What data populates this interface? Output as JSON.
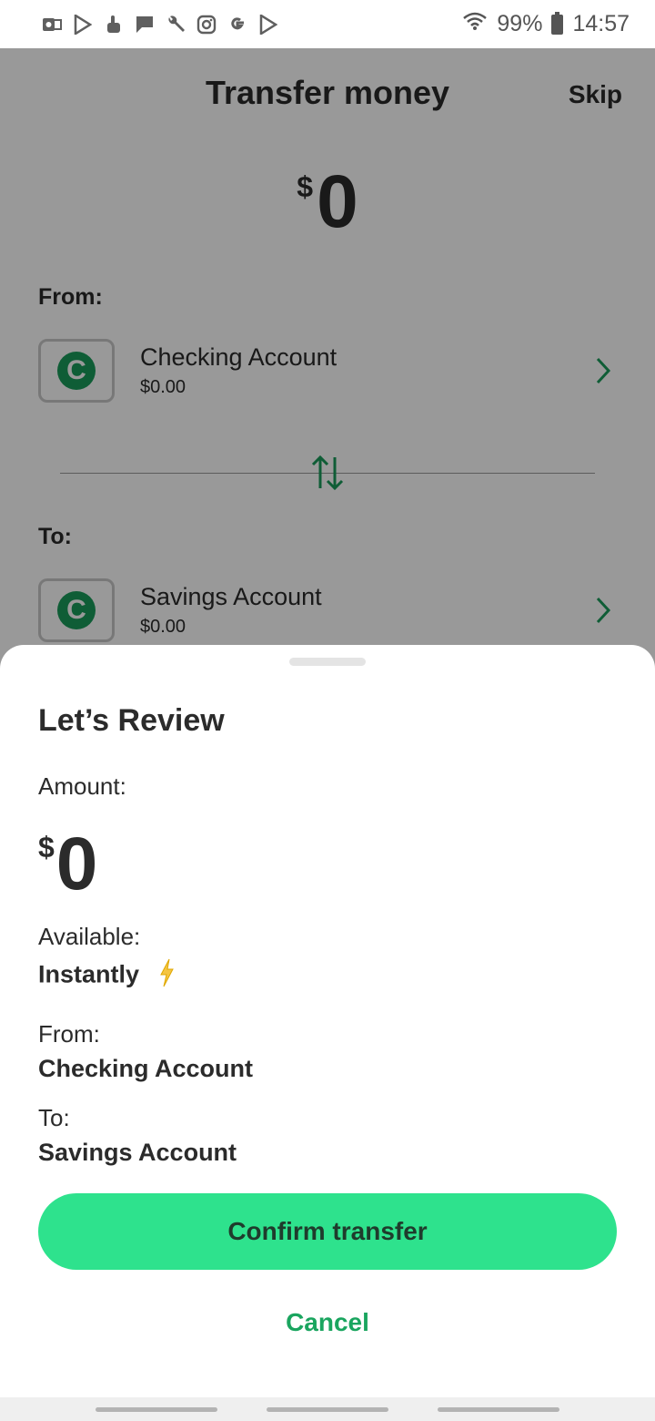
{
  "status_bar": {
    "battery": "99%",
    "time": "14:57",
    "left_icons": [
      "outlook-icon",
      "play-store-icon",
      "hand-icon",
      "flag-icon",
      "wrench-icon",
      "instagram-icon",
      "google-icon",
      "play-store-icon"
    ]
  },
  "header": {
    "title": "Transfer money",
    "skip_label": "Skip"
  },
  "transfer": {
    "currency": "$",
    "amount": "0",
    "from_label": "From:",
    "to_label": "To:",
    "from_account": {
      "logo_letter": "C",
      "name": "Checking Account",
      "balance": "$0.00"
    },
    "to_account": {
      "logo_letter": "C",
      "name": "Savings Account",
      "balance": "$0.00"
    }
  },
  "review": {
    "title": "Let’s Review",
    "amount_label": "Amount:",
    "currency": "$",
    "amount": "0",
    "available_label": "Available:",
    "available_value": "Instantly",
    "from_label": "From:",
    "from_value": "Checking Account",
    "to_label": "To:",
    "to_value": "Savings Account",
    "confirm_label": "Confirm transfer",
    "cancel_label": "Cancel"
  },
  "colors": {
    "accent_green": "#2ee28d",
    "link_green": "#1aa55f",
    "logo_green": "#1a9b5a"
  }
}
